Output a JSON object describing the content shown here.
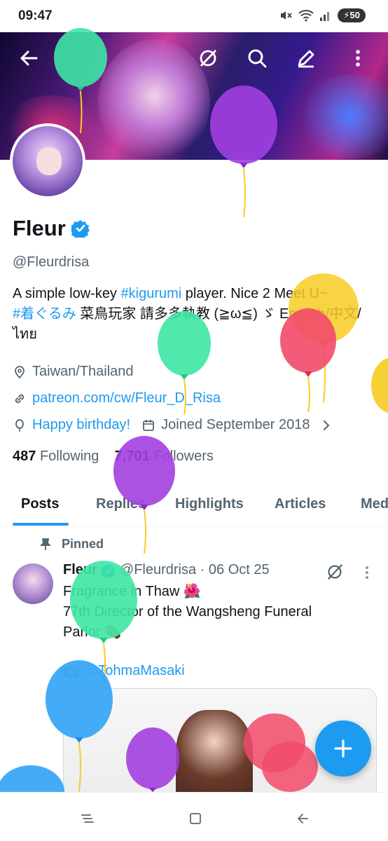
{
  "status_bar": {
    "time": "09:47",
    "battery": "50"
  },
  "profile": {
    "name": "Fleur",
    "handle": "@Fleurdrisa",
    "bio": {
      "part1": "A simple low-key ",
      "tag1": "#kigurumi",
      "part2": " player. Nice 2 Meet U~",
      "tag2": "#着ぐるみ",
      "part3": " 菜鳥玩家 請多多執教 (≧ω≦) ゞ English/中文/",
      "part4": "ไทย"
    },
    "location": "Taiwan/Thailand",
    "website": "patreon.com/cw/Fleur_D_Risa",
    "birthday": "Happy birthday!",
    "joined": "Joined September 2018",
    "following_count": "487",
    "following_label": "Following",
    "followers_count": "7,701",
    "followers_label": "Followers"
  },
  "tabs": [
    "Posts",
    "Replies",
    "Highlights",
    "Articles",
    "Media"
  ],
  "post": {
    "pinned_label": "Pinned",
    "author": "Fleur",
    "handle_date": "@Fleurdrisa · 06 Oct 25",
    "line1": "Fragrance in Thaw 🌺",
    "line2": "77th Director of the Wangsheng Funeral",
    "line3": "Parlor ⚰️",
    "mention": "@TohmaMasaki"
  },
  "colors": {
    "accent": "#1d9bf0",
    "text": "#0f1419",
    "muted": "#536471",
    "balloon_green": "#3ee6a4",
    "balloon_purple": "#a23fe0",
    "balloon_yellow": "#f7cc24",
    "balloon_red": "#f24a6a",
    "balloon_blue": "#3aa8f5"
  }
}
